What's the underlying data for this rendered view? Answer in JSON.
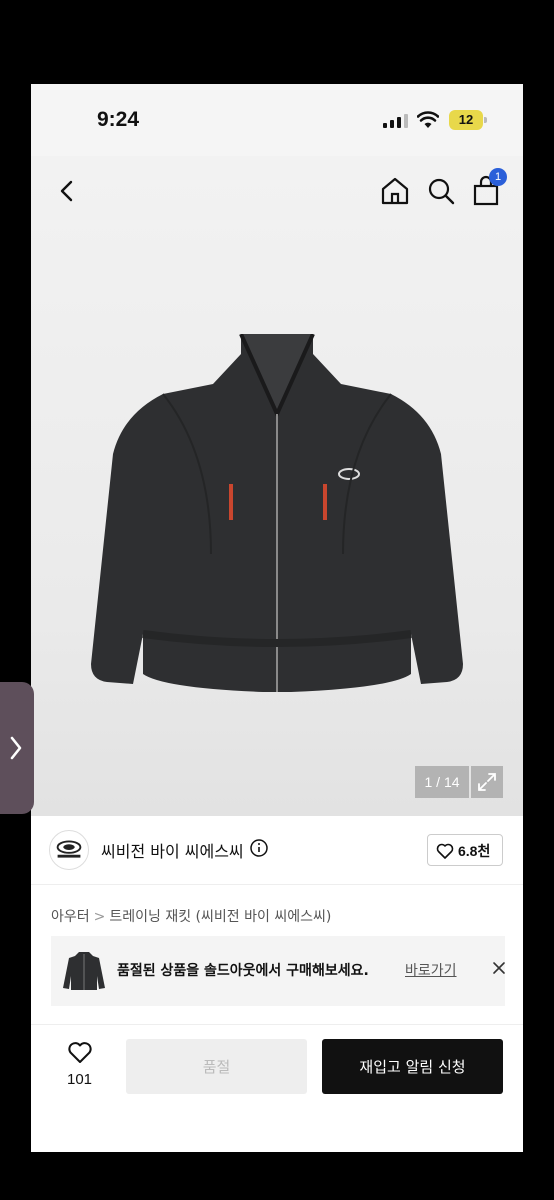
{
  "status_bar": {
    "time": "9:24",
    "battery": "12"
  },
  "nav": {
    "cart_count": "1"
  },
  "gallery": {
    "counter": "1 / 14"
  },
  "brand": {
    "name": "씨비전 바이 씨에스씨",
    "like_count": "6.8천"
  },
  "breadcrumb": {
    "category": "아우터",
    "separator": ">",
    "product": "트레이닝 재킷 (씨비전 바이 씨에스씨)"
  },
  "soldout_banner": {
    "message": "품절된 상품을 솔드아웃에서 구매해보세요.",
    "link_label": "바로가기"
  },
  "bottom_bar": {
    "wish_count": "101",
    "soldout_label": "품절",
    "restock_label": "재입고 알림 신청"
  },
  "colors": {
    "badge": "#2a5fd9",
    "primary_button": "#111111",
    "battery": "#e8d84a"
  },
  "icons": [
    "back-icon",
    "home-icon",
    "search-icon",
    "bag-icon",
    "expand-icon",
    "info-icon",
    "heart-icon",
    "close-icon",
    "chevron-right-icon"
  ]
}
